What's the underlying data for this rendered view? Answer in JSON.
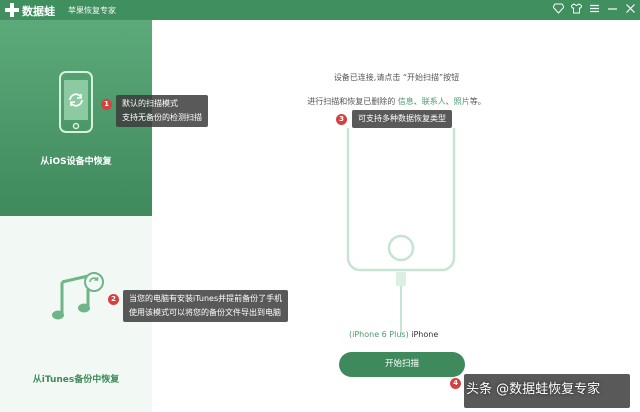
{
  "app": {
    "name": "数据蛙",
    "subtitle": "苹果恢复专家"
  },
  "window_controls": [
    "gem-icon",
    "shirt-icon",
    "menu-icon",
    "minimize-icon",
    "close-icon"
  ],
  "sidebar": {
    "items": [
      {
        "label": "从iOS设备中恢复",
        "active": true,
        "icon": "phone-restore-icon"
      },
      {
        "label": "从iTunes备份中恢复",
        "active": false,
        "icon": "itunes-music-icon"
      }
    ]
  },
  "main": {
    "line1": "设备已连接,请点击 “开始扫描”按钮",
    "line2_prefix": "进行扫描和恢复已删除的 ",
    "line2_info": "信息",
    "line2_sep1": "、",
    "line2_contacts": "联系人",
    "line2_sep2": "、",
    "line2_photos": "照片",
    "line2_suffix": "等。",
    "device_model": "(iPhone 6 Plus)",
    "device_name": " iPhone",
    "start_button": "开始扫描"
  },
  "callouts": [
    {
      "badge": "1",
      "lines": [
        "默认的扫描模式",
        "支持无备份的检测扫描"
      ]
    },
    {
      "badge": "2",
      "lines": [
        "当您的电脑有安装iTunes并提前备份了手机",
        "使用该模式可以将您的备份文件导出到电脑"
      ]
    },
    {
      "badge": "3",
      "lines": [
        "可支持多种数据恢复类型"
      ]
    },
    {
      "badge": "4",
      "lines": [
        "…"
      ]
    }
  ],
  "watermark": "头条 @数据蛙恢复专家",
  "colors": {
    "brand": "#3f8a5c",
    "accent_text": "#4a9a6a",
    "badge": "#d84040"
  }
}
